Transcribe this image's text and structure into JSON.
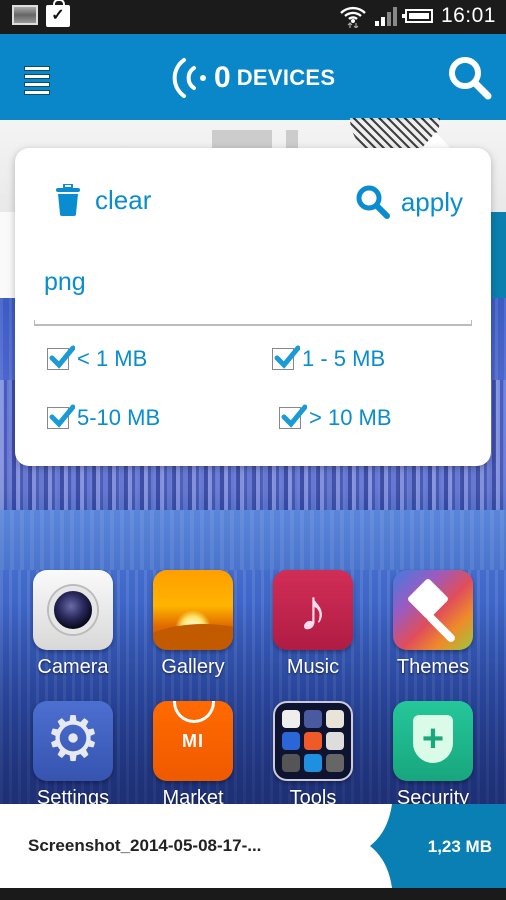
{
  "status_bar": {
    "time": "16:01",
    "icons": [
      "screenshot-notification-icon",
      "store-download-icon",
      "wifi-icon",
      "signal-icon",
      "battery-icon"
    ]
  },
  "action_bar": {
    "device_count": "0",
    "title": "DEVICES",
    "icons": {
      "menu": "hamburger-menu-icon",
      "devices": "broadcast-icon",
      "search": "search-icon"
    },
    "accent_color": "#0a87c9"
  },
  "filter_popup": {
    "clear_label": "clear",
    "apply_label": "apply",
    "query_value": "png",
    "size_filters": [
      {
        "label": "< 1 MB",
        "checked": true
      },
      {
        "label": "1 - 5 MB",
        "checked": true
      },
      {
        "label": "5-10 MB",
        "checked": true
      },
      {
        "label": "> 10 MB",
        "checked": true
      }
    ],
    "text_color": "#0a8dd0"
  },
  "home_apps": [
    {
      "label": "Camera"
    },
    {
      "label": "Gallery"
    },
    {
      "label": "Music"
    },
    {
      "label": "Themes"
    },
    {
      "label": "Settings"
    },
    {
      "label": "Market"
    },
    {
      "label": "Tools"
    },
    {
      "label": "Security"
    }
  ],
  "file_bar": {
    "file_name": "Screenshot_2014-05-08-17-...",
    "file_size": "1,23 MB",
    "tag_color": "#0a7fb4"
  }
}
